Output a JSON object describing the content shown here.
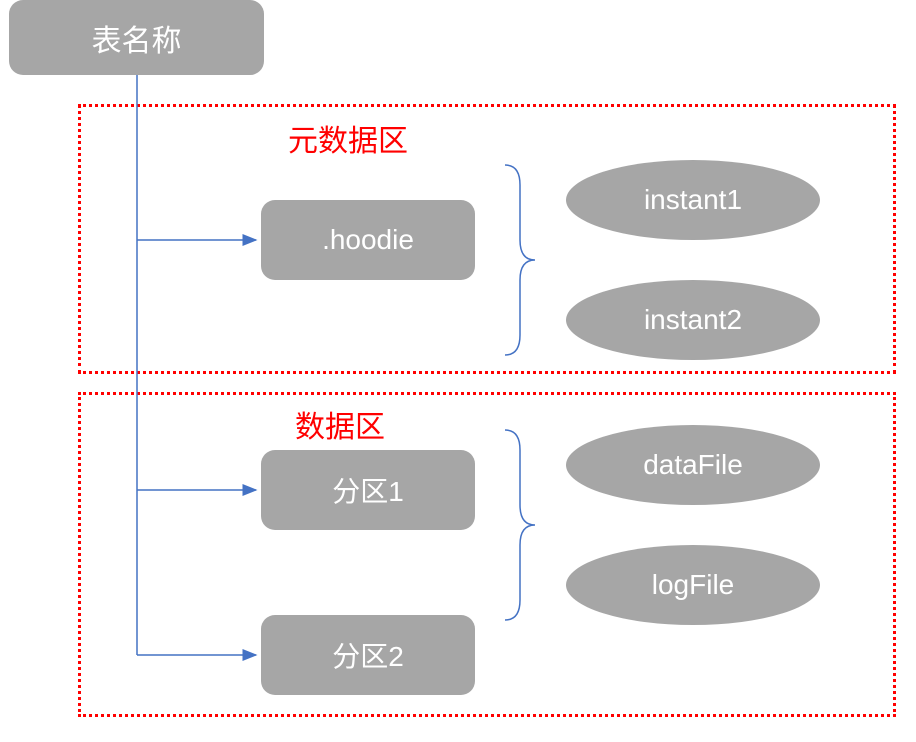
{
  "root": {
    "label": "表名称"
  },
  "metadataRegion": {
    "label": "元数据区",
    "hoodie": ".hoodie",
    "instant1": "instant1",
    "instant2": "instant2"
  },
  "dataRegion": {
    "label": "数据区",
    "partition1": "分区1",
    "partition2": "分区2",
    "dataFile": "dataFile",
    "logFile": "logFile"
  },
  "colors": {
    "nodeFill": "#a6a6a6",
    "regionBorder": "#ff0000",
    "arrow": "#4472c4"
  }
}
